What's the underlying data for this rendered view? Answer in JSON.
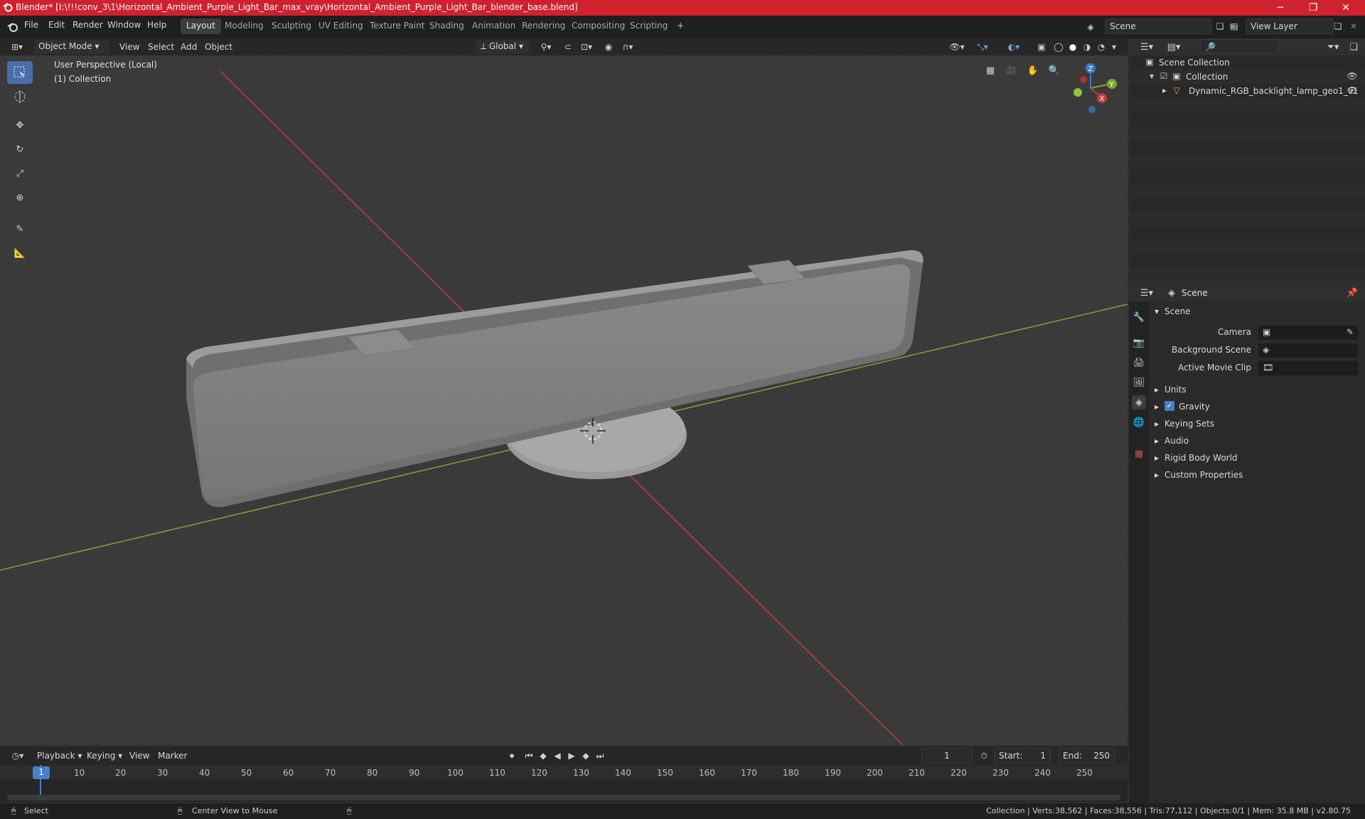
{
  "window": {
    "title": "Blender* [I:\\!!!conv_3\\1\\Horizontal_Ambient_Purple_Light_Bar_max_vray\\Horizontal_Ambient_Purple_Light_Bar_blender_base.blend]",
    "minimize": "─",
    "maximize": "❐",
    "close": "✕"
  },
  "menu": [
    "File",
    "Edit",
    "Render",
    "Window",
    "Help"
  ],
  "workspaces": [
    "Layout",
    "Modeling",
    "Sculpting",
    "UV Editing",
    "Texture Paint",
    "Shading",
    "Animation",
    "Rendering",
    "Compositing",
    "Scripting"
  ],
  "workspace_add": "+",
  "scene_field": "Scene",
  "view_layer_field": "View Layer",
  "viewport_header": {
    "mode": "Object Mode",
    "view": "View",
    "select": "Select",
    "add": "Add",
    "object": "Object",
    "transform": "Global"
  },
  "viewport": {
    "perspective": "User Perspective (Local)",
    "collection": "(1) Collection",
    "axis_z": "Z",
    "axis_y": "Y",
    "axis_x": "X"
  },
  "outliner": {
    "scene_collection": "Scene Collection",
    "collection": "Collection",
    "object": "Dynamic_RGB_backlight_lamp_geo1_v1"
  },
  "properties": {
    "header": "Scene",
    "section": "Scene",
    "camera_label": "Camera",
    "background_scene_label": "Background Scene",
    "active_movie_clip_label": "Active Movie Clip",
    "sections": [
      "Units",
      "Gravity",
      "Keying Sets",
      "Audio",
      "Rigid Body World",
      "Custom Properties"
    ]
  },
  "timeline": {
    "playback": "Playback",
    "keying": "Keying",
    "view": "View",
    "marker": "Marker",
    "current_frame": "1",
    "start_label": "Start:",
    "start": "1",
    "end_label": "End:",
    "end": "250",
    "ticks": [
      "1",
      "10",
      "20",
      "30",
      "40",
      "50",
      "60",
      "70",
      "80",
      "90",
      "100",
      "110",
      "120",
      "130",
      "140",
      "150",
      "160",
      "170",
      "180",
      "190",
      "200",
      "210",
      "220",
      "230",
      "240",
      "250"
    ]
  },
  "status": {
    "select": "Select",
    "center": "Center View to Mouse",
    "stats": "Collection | Verts:38,562 | Faces:38,556 | Tris:77,112 | Objects:0/1 | Mem: 35.8 MB | v2.80.75"
  },
  "colors": {
    "titlebar": "#d0212e",
    "active_tool": "#4a6fa8",
    "x_axis": "#c43b3b",
    "y_axis": "#7fa52f",
    "z_axis": "#3b7ac4"
  }
}
